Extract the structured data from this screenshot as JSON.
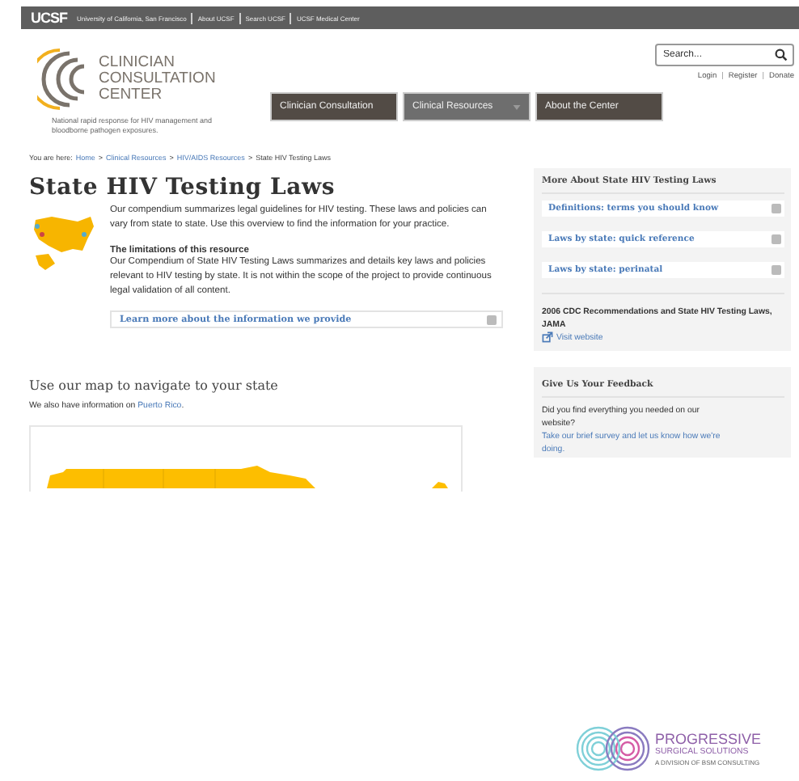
{
  "top_bar": {
    "logo": "UCSF",
    "links": [
      "University of California, San Francisco",
      "About UCSF",
      "Search UCSF",
      "UCSF Medical Center"
    ]
  },
  "header": {
    "logo_lines": [
      "CLINICIAN",
      "CONSULTATION",
      "CENTER"
    ],
    "tagline": "National rapid response for HIV management and bloodborne pathogen exposures.",
    "search": {
      "placeholder": "Search..."
    },
    "account_links": [
      "Login",
      "Register",
      "Donate"
    ],
    "account_separator": "|",
    "nav": [
      {
        "label": "Clinician Consultation",
        "selected": false,
        "has_menu": false
      },
      {
        "label": "Clinical Resources",
        "selected": true,
        "has_menu": true
      },
      {
        "label": "About the Center",
        "selected": false,
        "has_menu": false
      }
    ]
  },
  "breadcrumb": {
    "prefix": "You are here:",
    "separator": ">",
    "items": [
      {
        "label": "Home",
        "link": true
      },
      {
        "label": "Clinical Resources",
        "link": true
      },
      {
        "label": "HIV/AIDS Resources",
        "link": true
      },
      {
        "label": "State HIV Testing Laws",
        "link": false
      }
    ]
  },
  "main": {
    "title": "State HIV Testing Laws",
    "intro": "Our compendium summarizes legal guidelines for HIV testing. These laws and policies can vary from state to state. Use this overview to find the information for your practice.",
    "limits_heading": "The limitations of this resource",
    "limits_text": "Our Compendium of State HIV Testing Laws summarizes and details key laws and policies relevant to HIV testing by state.  It is not within the scope of the project to provide continuous legal validation of all content.",
    "accordion": {
      "label": "Learn more about the information we provide",
      "expanded": false
    },
    "map_heading": "Use our map to navigate to your state",
    "map_note": "We also have information on",
    "map_link": "Puerto Rico",
    "map_note_end": "."
  },
  "sidebar": {
    "heading": "More About State HIV Testing Laws",
    "items": [
      {
        "label": "Definitions: terms you should know",
        "expanded": false
      },
      {
        "label": "Laws by state: quick reference",
        "expanded": false
      },
      {
        "label": "Laws by state: perinatal",
        "expanded": false
      }
    ],
    "reference": "2006 CDC Recommendations and State HIV Testing Laws, JAMA",
    "reference_link": "Visit website"
  },
  "feedback": {
    "heading": "Give Us Your Feedback",
    "text": "Did you find everything you needed on our website?",
    "link": "Take our brief survey and let us know how we're doing."
  },
  "ad": {
    "name": "PROGRESSIVE",
    "subtitle": "SURGICAL SOLUTIONS",
    "division": "A DIVISION OF BSM CONSULTING"
  }
}
